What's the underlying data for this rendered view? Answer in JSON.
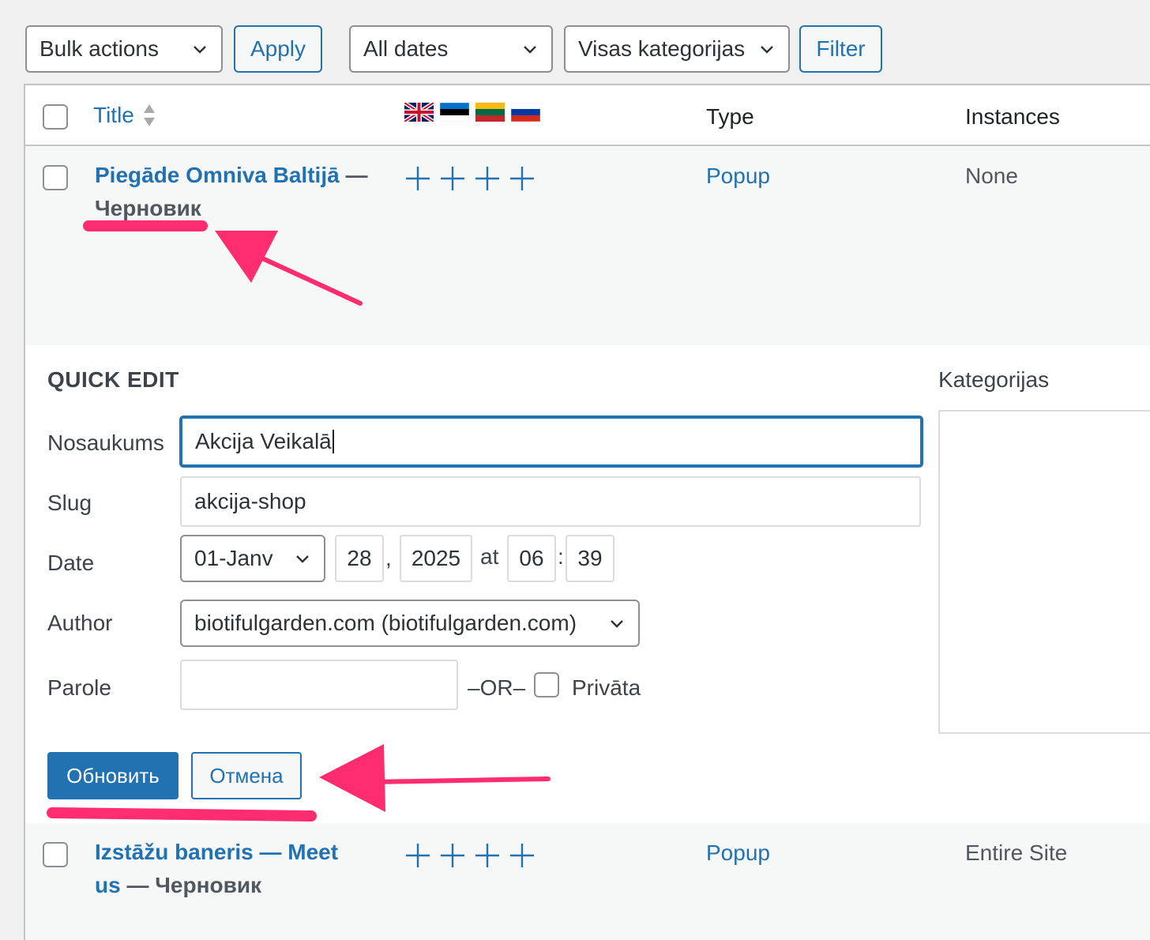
{
  "toolbar": {
    "bulk_actions": "Bulk actions",
    "apply": "Apply",
    "all_dates": "All dates",
    "categories": "Visas kategorijas",
    "filter": "Filter"
  },
  "table": {
    "headers": {
      "title": "Title",
      "type": "Type",
      "instances": "Instances"
    },
    "language_flags": [
      "uk-flag-icon",
      "estonia-flag-icon",
      "lithuania-flag-icon",
      "russia-flag-icon"
    ],
    "rows": [
      {
        "title": "Piegāde Omniva Baltijā",
        "separator": " — ",
        "state": "Черновик",
        "type": "Popup",
        "instances": "None"
      },
      {
        "title": "Izstāžu baneris — Meet us",
        "title_line1": "Izstāžu baneris — Meet",
        "title_line2": "us",
        "separator": " — ",
        "state": "Черновик",
        "type": "Popup",
        "instances": "Entire Site"
      }
    ]
  },
  "quick_edit": {
    "heading": "QUICK EDIT",
    "title_label": "Nosaukums",
    "title_value": "Akcija Veikalā",
    "slug_label": "Slug",
    "slug_value": "akcija-shop",
    "date_label": "Date",
    "month": "01-Janv",
    "day": "28",
    "comma": ",",
    "year": "2025",
    "at": "at",
    "hour": "06",
    "colon": ":",
    "minute": "39",
    "author_label": "Author",
    "author_value": "biotifulgarden.com (biotifulgarden.com)",
    "password_label": "Parole",
    "password_value": "",
    "or": "–OR–",
    "private_label": "Privāta",
    "categories_label": "Kategorijas",
    "update_button": "Обновить",
    "cancel_button": "Отмена"
  },
  "colors": {
    "accent": "#2271b1",
    "annotation": "#ff2d6f",
    "row_bg": "#f6f7f7"
  }
}
